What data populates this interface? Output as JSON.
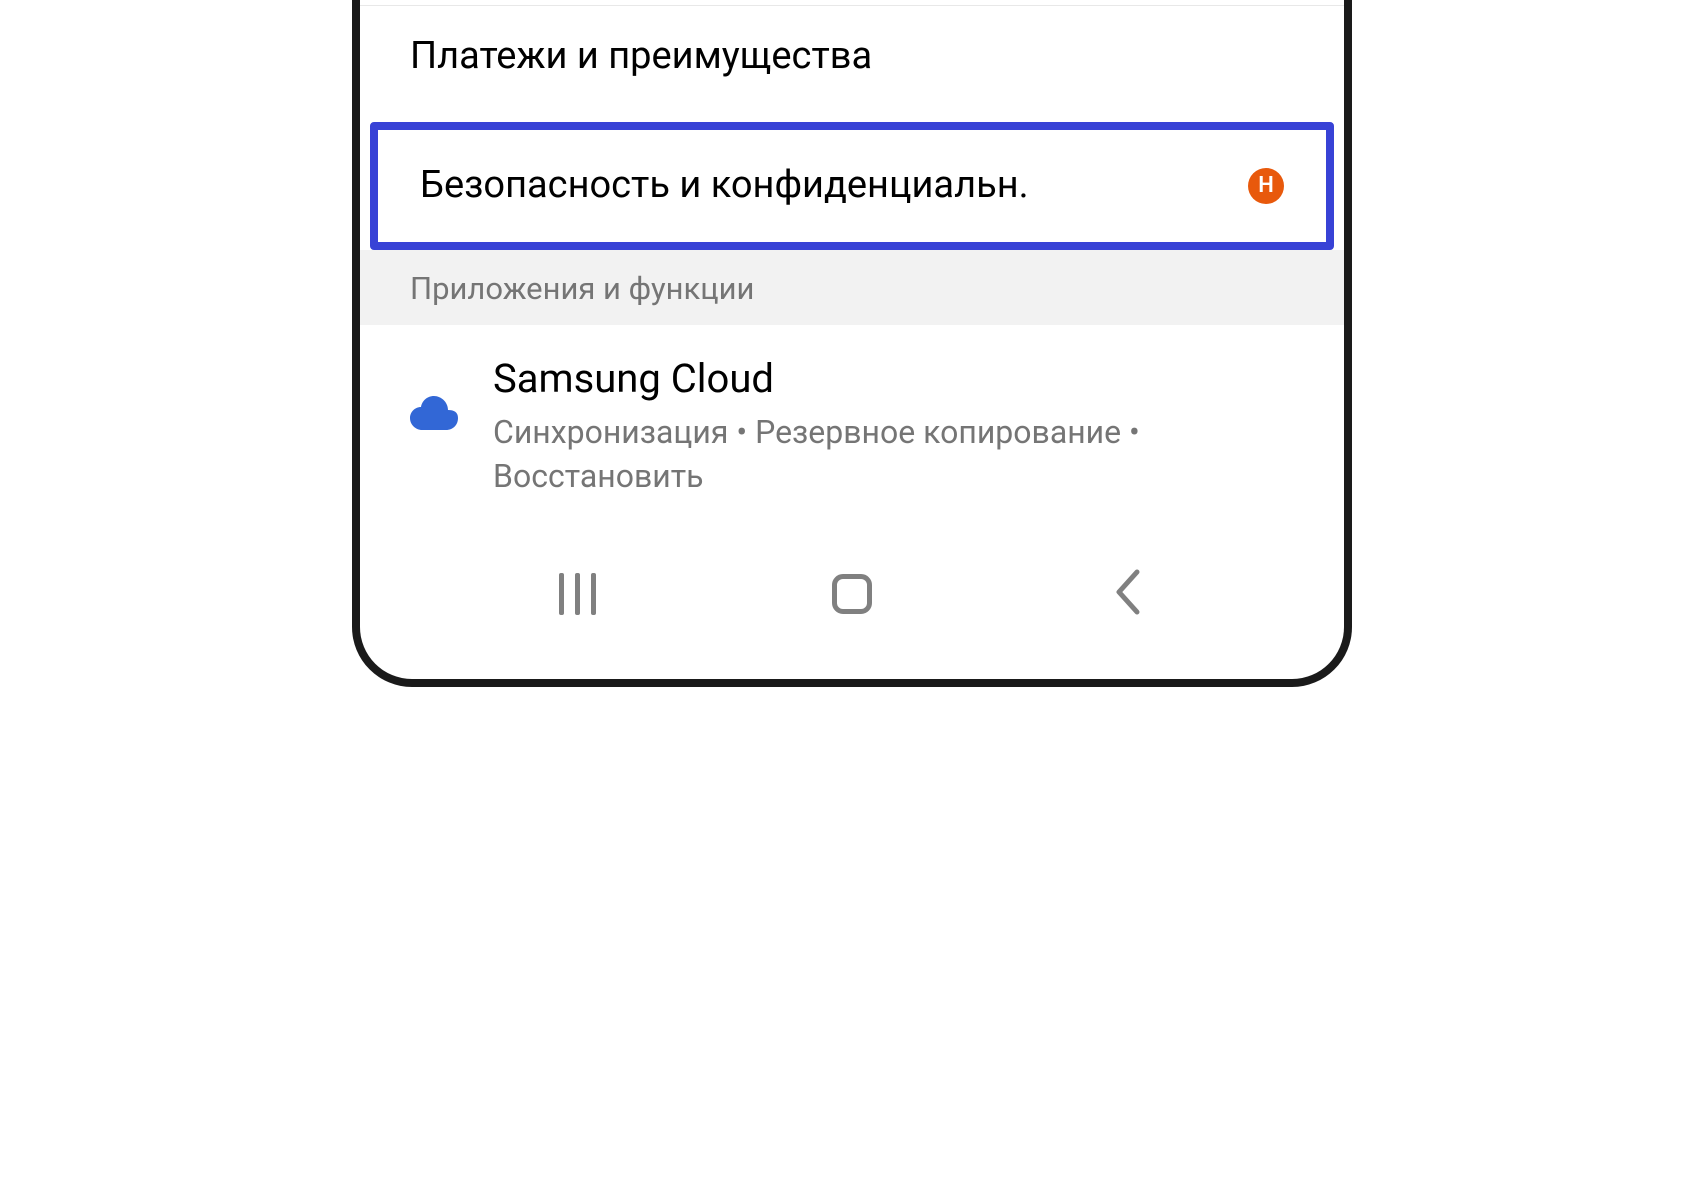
{
  "settings": {
    "payments_item": "Платежи и преимущества",
    "security_item": "Безопасность и конфиденциальн.",
    "security_badge": "Н"
  },
  "section_header": "Приложения и функции",
  "app": {
    "title": "Samsung Cloud",
    "subtitle": "Синхронизация  •  Резервное копирование  •  Восстановить"
  }
}
